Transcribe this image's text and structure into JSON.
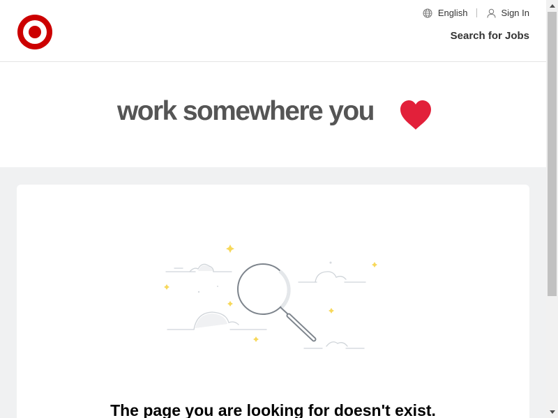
{
  "header": {
    "language_label": "English",
    "signin_label": "Sign In",
    "search_jobs_label": "Search for Jobs"
  },
  "banner": {
    "tagline": "work somewhere you"
  },
  "error": {
    "message": "The page you are looking for doesn't exist."
  },
  "colors": {
    "brand_red": "#cc0000",
    "heart_red": "#e2203a",
    "page_bg": "#f0f1f2"
  },
  "icons": [
    "target-logo-icon",
    "globe-icon",
    "user-icon",
    "heart-icon",
    "magnifier-illustration"
  ]
}
